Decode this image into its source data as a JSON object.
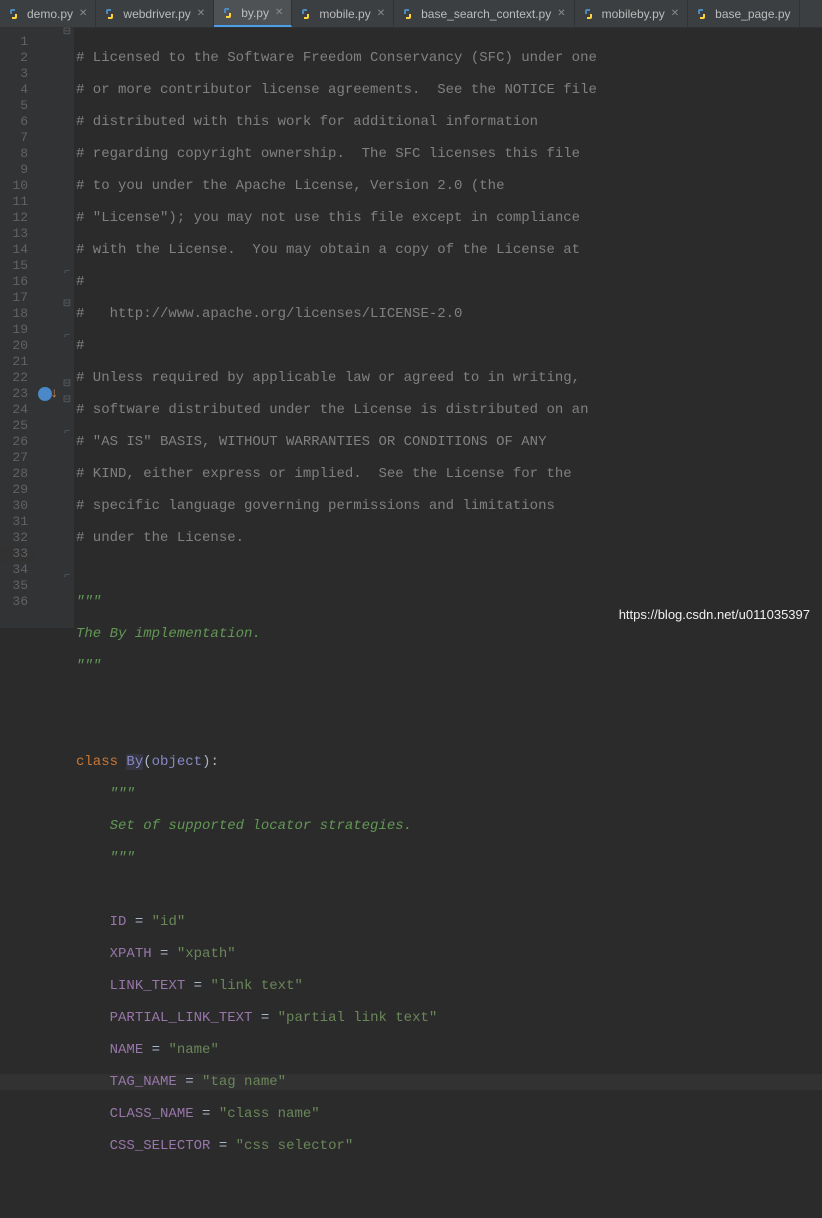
{
  "tabs": [
    {
      "label": "demo.py",
      "active": false,
      "close": true
    },
    {
      "label": "webdriver.py",
      "active": false,
      "close": true
    },
    {
      "label": "by.py",
      "active": true,
      "close": true
    },
    {
      "label": "mobile.py",
      "active": false,
      "close": true
    },
    {
      "label": "base_search_context.py",
      "active": false,
      "close": true
    },
    {
      "label": "mobileby.py",
      "active": false,
      "close": true
    },
    {
      "label": "base_page.py",
      "active": false,
      "close": false
    }
  ],
  "lines": {
    "l1": "# Licensed to the Software Freedom Conservancy (SFC) under one",
    "l2": "# or more contributor license agreements.  See the NOTICE file",
    "l3": "# distributed with this work for additional information",
    "l4": "# regarding copyright ownership.  The SFC licenses this file",
    "l5": "# to you under the Apache License, Version 2.0 (the",
    "l6": "# \"License\"); you may not use this file except in compliance",
    "l7": "# with the License.  You may obtain a copy of the License at",
    "l8": "#",
    "l9": "#   http://www.apache.org/licenses/LICENSE-2.0",
    "l10": "#",
    "l11": "# Unless required by applicable law or agreed to in writing,",
    "l12": "# software distributed under the License is distributed on an",
    "l13": "# \"AS IS\" BASIS, WITHOUT WARRANTIES OR CONDITIONS OF ANY",
    "l14": "# KIND, either express or implied.  See the License for the",
    "l15": "# specific language governing permissions and limitations",
    "l16": "# under the License.",
    "doc1": "\"\"\"",
    "doc2": "The By implementation.",
    "doc3": "\"\"\"",
    "cls_kw": "class ",
    "cls_name": "By",
    "cls_open": "(",
    "cls_base": "object",
    "cls_close": "):",
    "cls_doc1": "\"\"\"",
    "cls_doc2": "Set of supported locator strategies.",
    "cls_doc3": "\"\"\"",
    "id_attr": "ID",
    "id_eq": " = ",
    "id_val": "\"id\"",
    "xp_attr": "XPATH",
    "xp_eq": " = ",
    "xp_val": "\"xpath\"",
    "lt_attr": "LINK_TEXT",
    "lt_eq": " = ",
    "lt_val": "\"link text\"",
    "plt_attr": "PARTIAL_LINK_TEXT",
    "plt_eq": " = ",
    "plt_val": "\"partial link text\"",
    "nm_attr": "NAME",
    "nm_eq": " = ",
    "nm_val": "\"name\"",
    "tn_attr": "TAG_NAME",
    "tn_eq": " = ",
    "tn_val": "\"tag name\"",
    "cn_attr": "CLASS_NAME",
    "cn_eq": " = ",
    "cn_val": "\"class name\"",
    "cs_attr": "CSS_SELECTOR",
    "cs_eq": " = ",
    "cs_val": "\"css selector\""
  },
  "line_count": 36,
  "highlighted_line": 33,
  "breakpoint_line": 23,
  "watermark": "https://blog.csdn.net/u011035397"
}
